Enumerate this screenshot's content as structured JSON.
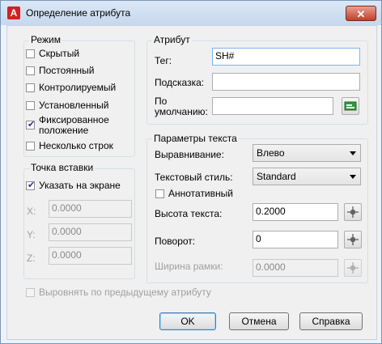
{
  "window": {
    "title": "Определение атрибута",
    "app_icon": "A",
    "close_glyph": "✕"
  },
  "mode": {
    "title": "Режим",
    "items": [
      {
        "label": "Скрытый",
        "checked": false
      },
      {
        "label": "Постоянный",
        "checked": false
      },
      {
        "label": "Контролируемый",
        "checked": false
      },
      {
        "label": "Установленный",
        "checked": false
      },
      {
        "label": "Фиксированное положение",
        "checked": true
      },
      {
        "label": "Несколько строк",
        "checked": false
      }
    ]
  },
  "insert_point": {
    "title": "Точка вставки",
    "specify_on_screen": {
      "label": "Указать на экране",
      "checked": true
    },
    "x": {
      "label": "X:",
      "value": "0.0000"
    },
    "y": {
      "label": "Y:",
      "value": "0.0000"
    },
    "z": {
      "label": "Z:",
      "value": "0.0000"
    }
  },
  "attribute": {
    "title": "Атрибут",
    "tag": {
      "label": "Тег:",
      "value": "SH#"
    },
    "prompt": {
      "label": "Подсказка:",
      "value": ""
    },
    "default": {
      "label_line1": "По",
      "label_line2": "умолчанию:",
      "value": ""
    }
  },
  "text_params": {
    "title": "Параметры текста",
    "justification": {
      "label": "Выравнивание:",
      "value": "Влево"
    },
    "text_style": {
      "label": "Текстовый стиль:",
      "value": "Standard"
    },
    "annotative": {
      "label": "Аннотативный",
      "checked": false
    },
    "text_height": {
      "label": "Высота текста:",
      "value": "0.2000"
    },
    "rotation": {
      "label": "Поворот:",
      "value": "0"
    },
    "boundary_width": {
      "label": "Ширина рамки:",
      "value": "0.0000"
    }
  },
  "align_prev": {
    "label": "Выровнять по предыдущему атрибуту",
    "checked": false
  },
  "buttons": {
    "ok": "OK",
    "cancel": "Отмена",
    "help": "Справка"
  },
  "icons": {
    "pick": "crosshair-pick-icon",
    "field": "insert-field-icon",
    "accent": "#3c7fb1"
  }
}
